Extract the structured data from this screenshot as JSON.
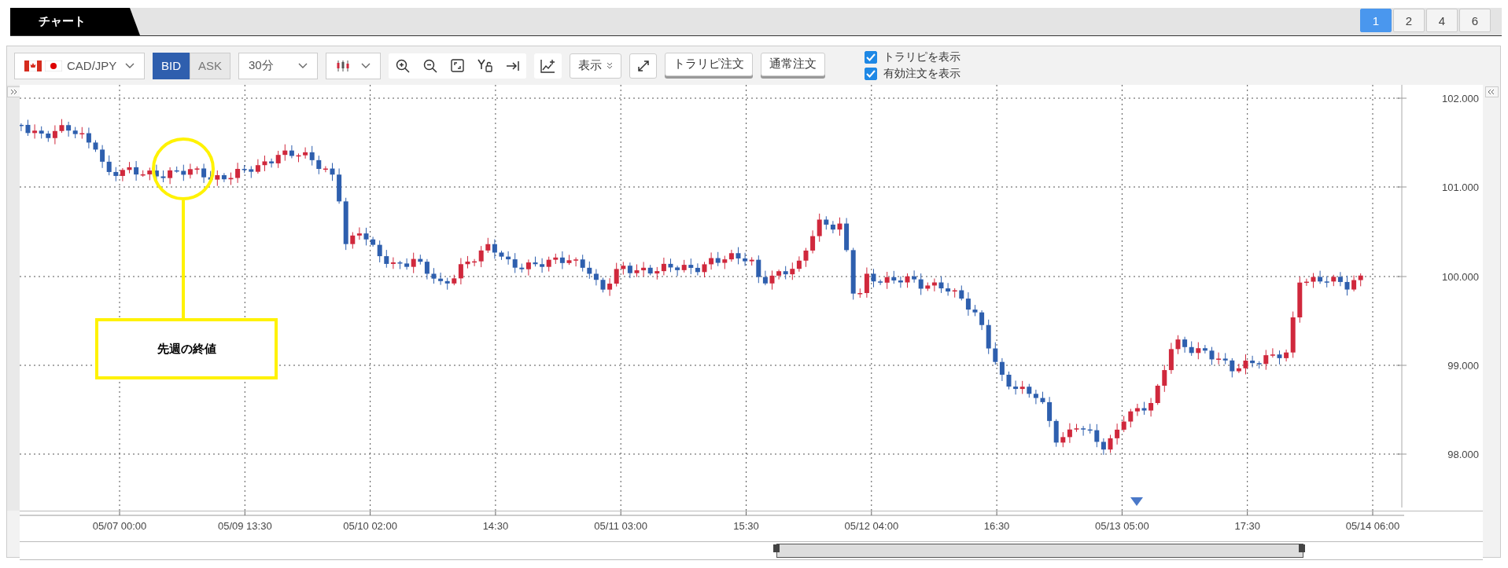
{
  "header": {
    "tab": "チャート",
    "layouts": [
      {
        "label": "1",
        "selected": true
      },
      {
        "label": "2",
        "selected": false
      },
      {
        "label": "4",
        "selected": false
      },
      {
        "label": "6",
        "selected": false
      }
    ]
  },
  "toolbar": {
    "pair": "CAD/JPY",
    "price_sides": [
      {
        "label": "BID",
        "selected": true
      },
      {
        "label": "ASK",
        "selected": false
      }
    ],
    "timeframe": "30分",
    "display_menu": "表示",
    "order_buttons": [
      "トラリピ注文",
      "通常注文"
    ],
    "options": [
      {
        "label": "トラリピを表示",
        "checked": true
      },
      {
        "label": "有効注文を表示",
        "checked": true
      }
    ]
  },
  "chart": {
    "y_labels": [
      "102.000",
      "101.000",
      "100.000",
      "99.000",
      "98.000"
    ],
    "x_labels": [
      "05/07 00:00",
      "05/09 13:30",
      "05/10 02:00",
      "14:30",
      "05/11 03:00",
      "15:30",
      "05/12 04:00",
      "16:30",
      "05/13 05:00",
      "17:30",
      "05/14 06:00"
    ],
    "annotation": "先週の終値"
  }
}
